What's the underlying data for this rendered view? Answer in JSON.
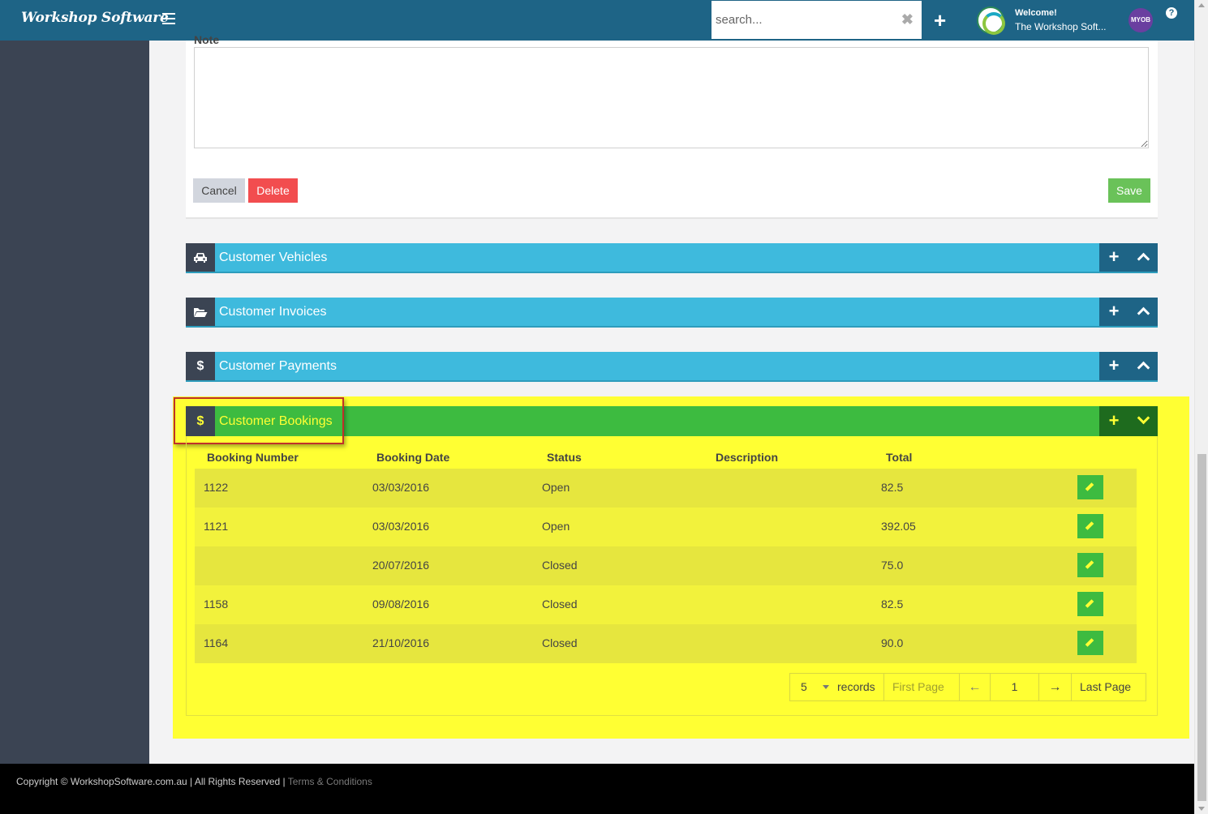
{
  "topbar": {
    "brand": "Workshop Software",
    "search_placeholder": "search...",
    "welcome_line1": "Welcome!",
    "welcome_line2": "The Workshop Soft...",
    "myob_label": "MYOB",
    "help_label": "?"
  },
  "note_panel": {
    "label": "Note",
    "value": "",
    "cancel_label": "Cancel",
    "delete_label": "Delete",
    "save_label": "Save"
  },
  "sections": {
    "vehicles": {
      "title": "Customer Vehicles",
      "icon": "car-icon"
    },
    "invoices": {
      "title": "Customer Invoices",
      "icon": "folder-open-icon"
    },
    "payments": {
      "title": "Customer Payments",
      "icon": "dollar-icon"
    },
    "bookings": {
      "title": "Customer Bookings",
      "icon": "dollar-icon"
    }
  },
  "bookings_table": {
    "columns": [
      "Booking Number",
      "Booking Date",
      "Status",
      "Description",
      "Total"
    ],
    "rows": [
      {
        "number": "1122",
        "date": "03/03/2016",
        "status": "Open",
        "description": "",
        "total": "82.5"
      },
      {
        "number": "1121",
        "date": "03/03/2016",
        "status": "Open",
        "description": "",
        "total": "392.05"
      },
      {
        "number": "",
        "date": "20/07/2016",
        "status": "Closed",
        "description": "",
        "total": "75.0"
      },
      {
        "number": "1158",
        "date": "09/08/2016",
        "status": "Closed",
        "description": "",
        "total": "82.5"
      },
      {
        "number": "1164",
        "date": "21/10/2016",
        "status": "Closed",
        "description": "",
        "total": "90.0"
      }
    ]
  },
  "pager": {
    "page_size": "5",
    "records_label": "records",
    "first_label": "First Page",
    "prev_label": "←",
    "current_page": "1",
    "next_label": "→",
    "last_label": "Last Page"
  },
  "footer": {
    "copyright": "Copyright © WorkshopSoftware.com.au | All Rights Reserved |",
    "terms": "Terms & Conditions"
  },
  "colors": {
    "topbar": "#1e6486",
    "sidebar": "#3b4453",
    "section_header": "#3ebadd",
    "bookings_header": "#3dbb40",
    "highlight": "#ffff33",
    "delete": "#f24d4f",
    "save": "#6ac259"
  }
}
